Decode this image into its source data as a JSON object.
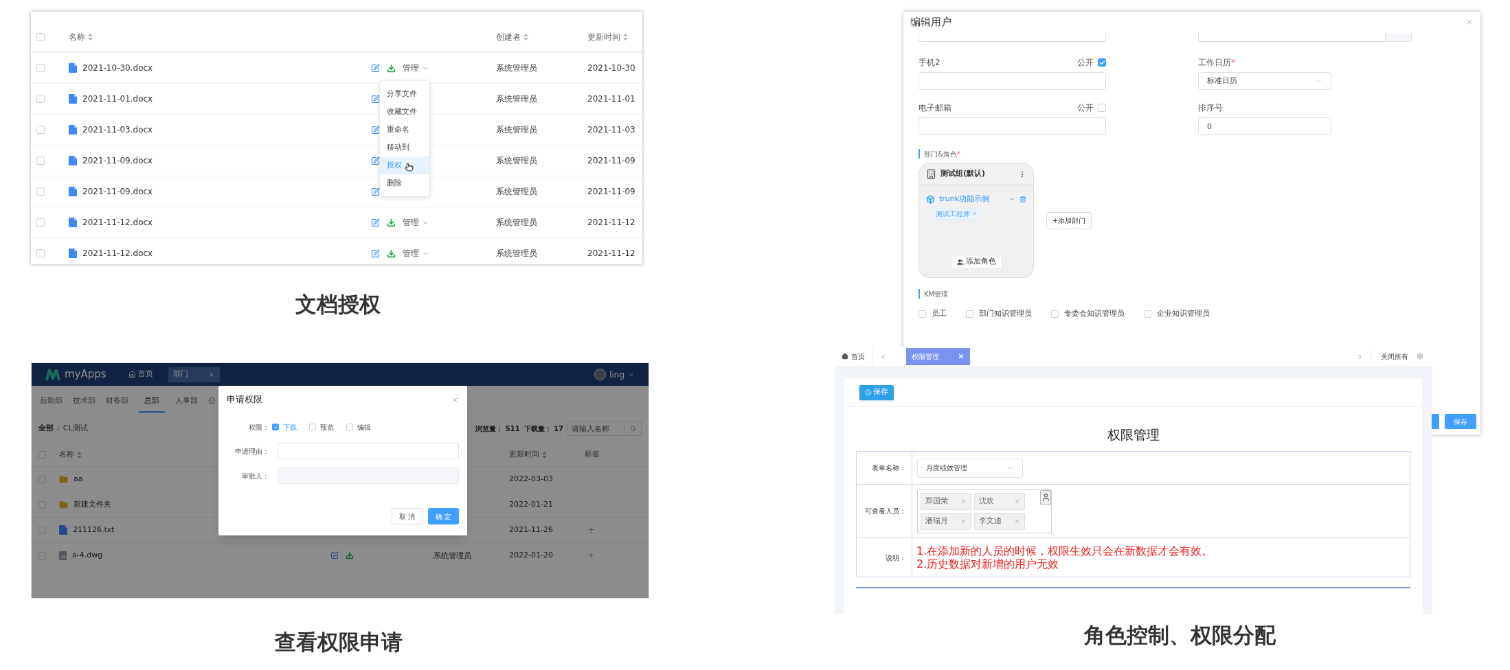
{
  "doc_authorization": {
    "caption": "文档授权",
    "select_all": false,
    "columns": [
      "名称",
      "创建者",
      "更新时间"
    ],
    "rows": [
      {
        "checked": false,
        "name": "2021-10-30.docx",
        "manage": "管理",
        "creator": "系统管理员",
        "updated": "2021-10-30"
      },
      {
        "checked": false,
        "name": "2021-11-01.docx",
        "creator": "系统管理员",
        "updated": "2021-11-01"
      },
      {
        "checked": false,
        "name": "2021-11-03.docx",
        "creator": "系统管理员",
        "updated": "2021-11-03"
      },
      {
        "checked": false,
        "name": "2021-11-09.docx",
        "creator": "系统管理员",
        "updated": "2021-11-09"
      },
      {
        "checked": false,
        "name": "2021-11-09.docx",
        "creator": "系统管理员",
        "updated": "2021-11-09"
      },
      {
        "checked": false,
        "name": "2021-11-12.docx",
        "manage": "管理",
        "creator": "系统管理员",
        "updated": "2021-11-12"
      },
      {
        "checked": false,
        "name": "2021-11-12.docx",
        "manage": "管理",
        "creator": "系统管理员",
        "updated": "2021-11-12"
      }
    ],
    "menu": [
      {
        "label": "分享文件",
        "selected": false
      },
      {
        "label": "收藏文件",
        "selected": false
      },
      {
        "label": "重命名",
        "selected": false
      },
      {
        "label": "移动到",
        "selected": false
      },
      {
        "label": "授权",
        "selected": true
      },
      {
        "label": "删除",
        "selected": false
      }
    ]
  },
  "permission_request": {
    "caption": "查看权限申请",
    "logo": "myApps",
    "nav": "首页",
    "open_tab": "部门",
    "user": "ling",
    "dept_tabs": [
      {
        "label": "后勤部",
        "selected": false
      },
      {
        "label": "技术部",
        "selected": false
      },
      {
        "label": "财务部",
        "selected": false
      },
      {
        "label": "总部",
        "selected": true
      },
      {
        "label": "人事部",
        "selected": false
      },
      {
        "label": "公",
        "selected": false
      }
    ],
    "breadcrumb": [
      "全部",
      "CL测试"
    ],
    "separator": "/",
    "views": "浏览量： 511",
    "downloads": "下载量： 17",
    "search": {
      "placeholder": "请输入名称"
    },
    "select_all": false,
    "columns": [
      "名称",
      "更新时间",
      "标签"
    ],
    "rows": [
      {
        "checked": false,
        "kind": "folder",
        "name": "aa",
        "updated": "2022-03-03"
      },
      {
        "checked": false,
        "kind": "folder",
        "name": "新建文件夹",
        "updated": "2022-01-21"
      },
      {
        "checked": false,
        "kind": "text",
        "name": "211126.txt",
        "updated": "2021-11-26",
        "tag_add": "+"
      },
      {
        "checked": false,
        "kind": "drawing",
        "name": "a-4.dwg",
        "actions": true,
        "creator": "系统管理员",
        "updated": "2022-01-20",
        "tag_add": "+"
      }
    ],
    "modal": {
      "title": "申请权限",
      "permission_label": "权限：",
      "options": [
        {
          "label": "下载",
          "checked": true
        },
        {
          "label": "预览",
          "checked": false
        },
        {
          "label": "编辑",
          "checked": false
        }
      ],
      "reason_label": "申请理由：",
      "approver_label": "审批人：",
      "cancel": "取 消",
      "ok": "确 定"
    }
  },
  "edit_user": {
    "title": "编辑用户",
    "phone2": {
      "label": "手机2",
      "public_label": "公开",
      "public": true
    },
    "email": {
      "label": "电子邮箱",
      "public_label": "公开",
      "public": false
    },
    "calendar": {
      "label": "工作日历",
      "required_mark": "*",
      "value": "标准日历"
    },
    "order": {
      "label": "排序号",
      "value": "0"
    },
    "dept_section": {
      "label": "部门&角色",
      "required_mark": "*"
    },
    "dept_card": {
      "name": "测试组(默认)",
      "unit": "trunk功能示例",
      "roles": [
        "测试工程师"
      ],
      "add_role": "添加角色"
    },
    "add_dept": "+添加部门",
    "km": {
      "label": "KM管理",
      "options": [
        {
          "label": "员工",
          "checked": false
        },
        {
          "label": "部门知识管理员",
          "checked": false
        },
        {
          "label": "专委会知识管理员",
          "checked": false
        },
        {
          "label": "企业知识管理员",
          "checked": false
        }
      ]
    },
    "save": "保存"
  },
  "permission_mgmt": {
    "caption": "角色控制、权限分配",
    "home": "首页",
    "tabs": [
      {
        "label": "权限管理",
        "selected": true
      }
    ],
    "close_all": "关闭所有",
    "save": "保存",
    "title": "权限管理",
    "form_label": "表单名称：",
    "form_value": "月度绩效管理",
    "viewers_label": "可查看人员：",
    "viewers": [
      "郑国荣",
      "沈欢",
      "潘瑞月",
      "李文迪"
    ],
    "note_label": "说明：",
    "notes": [
      "1.在添加新的人员的时候，权限生效只会在新数据才会有效。",
      "2.历史数据对新增的用户无效"
    ]
  }
}
